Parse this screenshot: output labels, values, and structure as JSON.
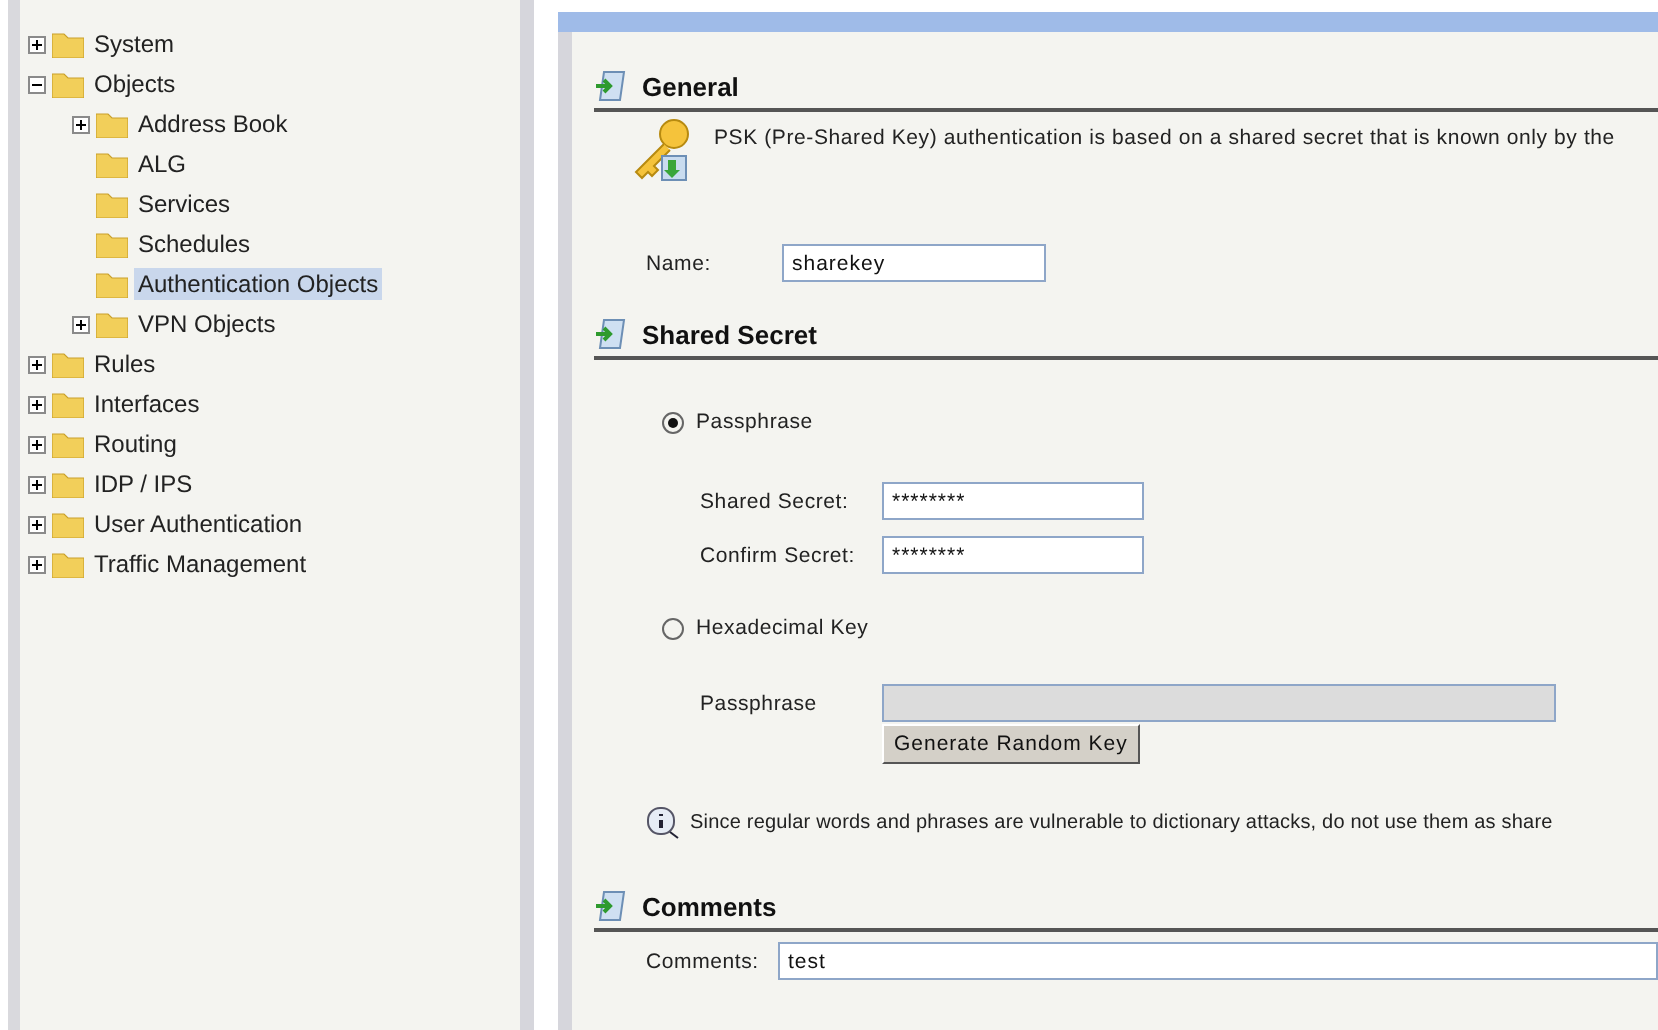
{
  "tree": [
    {
      "label": "System",
      "expanded": false,
      "selected": false
    },
    {
      "label": "Objects",
      "expanded": true,
      "selected": false,
      "children": [
        {
          "label": "Address Book",
          "expanded": false,
          "selected": false
        },
        {
          "label": "ALG",
          "selected": false
        },
        {
          "label": "Services",
          "selected": false
        },
        {
          "label": "Schedules",
          "selected": false
        },
        {
          "label": "Authentication Objects",
          "selected": true
        },
        {
          "label": "VPN Objects",
          "expanded": false,
          "selected": false
        }
      ]
    },
    {
      "label": "Rules",
      "expanded": false,
      "selected": false
    },
    {
      "label": "Interfaces",
      "expanded": false,
      "selected": false
    },
    {
      "label": "Routing",
      "expanded": false,
      "selected": false
    },
    {
      "label": "IDP / IPS",
      "expanded": false,
      "selected": false
    },
    {
      "label": "User Authentication",
      "expanded": false,
      "selected": false
    },
    {
      "label": "Traffic Management",
      "expanded": false,
      "selected": false
    }
  ],
  "general": {
    "title": "General",
    "description": "PSK (Pre-Shared Key) authentication is based on a shared secret that is known only by the",
    "name_field": {
      "label": "Name:",
      "value": "sharekey"
    }
  },
  "shared_secret": {
    "title": "Shared Secret",
    "options": [
      {
        "label": "Passphrase",
        "selected": true,
        "fields": [
          {
            "label": "Shared Secret:",
            "value": "********",
            "disabled": false
          },
          {
            "label": "Confirm Secret:",
            "value": "********",
            "disabled": false
          }
        ]
      },
      {
        "label": "Hexadecimal Key",
        "selected": false,
        "fields": [
          {
            "label": "Passphrase",
            "disabled": true
          }
        ],
        "button": "Generate Random Key"
      }
    ],
    "note": "Since regular words and phrases are vulnerable to dictionary attacks, do not use them as share"
  },
  "comments": {
    "title": "Comments",
    "field": {
      "label": "Comments:",
      "value": "test"
    }
  }
}
